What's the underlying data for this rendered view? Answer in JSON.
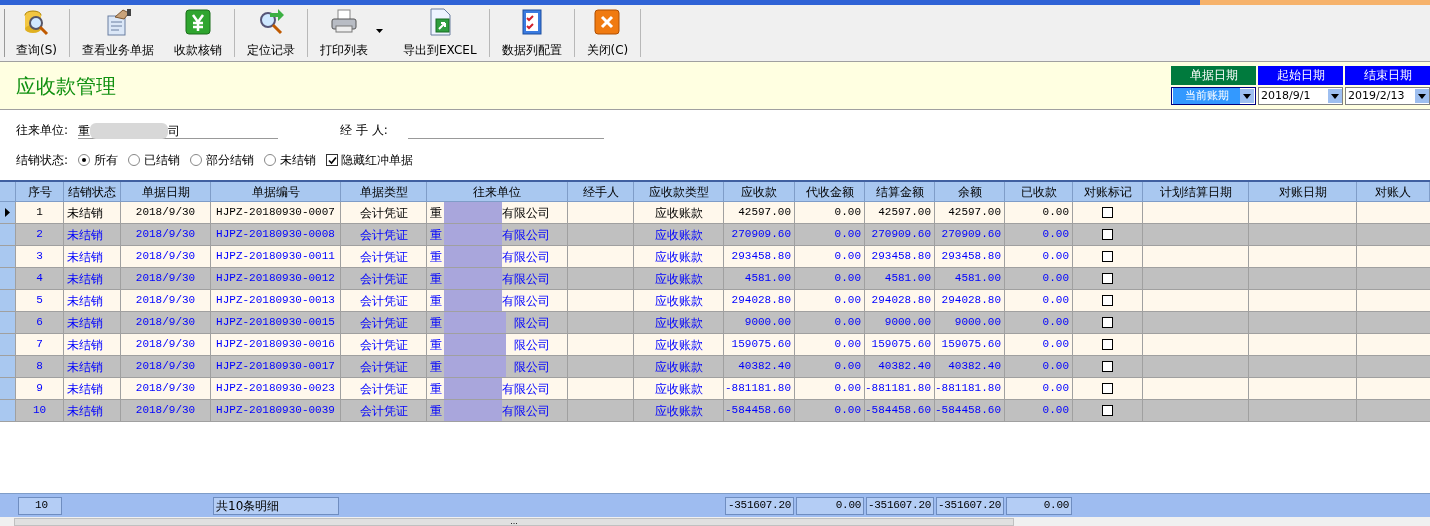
{
  "toolbar": [
    {
      "kind": "query",
      "label": "查询(S)",
      "has_menu": false
    },
    {
      "kind": "document",
      "label": "查看业务单据",
      "has_menu": false
    },
    {
      "kind": "yen",
      "label": "收款核销",
      "has_menu": false
    },
    {
      "kind": "locate",
      "label": "定位记录",
      "has_menu": false
    },
    {
      "kind": "print",
      "label": "打印列表",
      "has_menu": true
    },
    {
      "kind": "export",
      "label": "导出到EXCEL",
      "has_menu": false
    },
    {
      "kind": "checklist",
      "label": "数据列配置",
      "has_menu": false
    },
    {
      "kind": "close",
      "label": "关闭(C)",
      "has_menu": false
    }
  ],
  "page_title": "应收款管理",
  "date_filters": [
    {
      "label": "单据日期",
      "color": "#007a3d",
      "value": "当前账期",
      "selected": true
    },
    {
      "label": "起始日期",
      "color": "#0000ff",
      "value": "2018/9/1",
      "selected": false
    },
    {
      "label": "结束日期",
      "color": "#0000ff",
      "value": "2019/2/13",
      "selected": false
    }
  ],
  "partner_field": {
    "label": "往来单位:",
    "value_start": "重",
    "value_end": "司"
  },
  "handler_field": {
    "label": "经 手 人:"
  },
  "status_filter": {
    "label": "结销状态:",
    "options": [
      {
        "label": "所有",
        "selected": true
      },
      {
        "label": "已结销",
        "selected": false
      },
      {
        "label": "部分结销",
        "selected": false
      },
      {
        "label": "未结销",
        "selected": false
      }
    ]
  },
  "hide_red_reversal": {
    "label": "隐藏红冲单据",
    "checked": true
  },
  "table": {
    "columns": [
      "序号",
      "结销状态",
      "单据日期",
      "单据编号",
      "单据类型",
      "往来单位",
      "经手人",
      "应收款类型",
      "应收款",
      "代收金额",
      "结算金额",
      "余额",
      "已收款",
      "对账标记",
      "计划结算日期",
      "对账日期",
      "对账人"
    ],
    "rows": [
      {
        "selected": true,
        "seq": "1",
        "status": "未结销",
        "date": "2018/9/30",
        "number": "HJPZ-20180930-0007",
        "type": "会计凭证",
        "partner_start": "重",
        "partner_end": "有限公司",
        "ar_type": "应收账款",
        "amount": "42597.00",
        "collected": "0.00",
        "settled": "42597.00",
        "balance": "42597.00",
        "received": "0.00",
        "reconciled": false
      },
      {
        "selected": false,
        "seq": "2",
        "status": "未结销",
        "date": "2018/9/30",
        "number": "HJPZ-20180930-0008",
        "type": "会计凭证",
        "partner_start": "重",
        "partner_end": "有限公司",
        "ar_type": "应收账款",
        "amount": "270909.60",
        "collected": "0.00",
        "settled": "270909.60",
        "balance": "270909.60",
        "received": "0.00",
        "reconciled": false
      },
      {
        "selected": false,
        "seq": "3",
        "status": "未结销",
        "date": "2018/9/30",
        "number": "HJPZ-20180930-0011",
        "type": "会计凭证",
        "partner_start": "重",
        "partner_end": "有限公司",
        "ar_type": "应收账款",
        "amount": "293458.80",
        "collected": "0.00",
        "settled": "293458.80",
        "balance": "293458.80",
        "received": "0.00",
        "reconciled": false
      },
      {
        "selected": false,
        "seq": "4",
        "status": "未结销",
        "date": "2018/9/30",
        "number": "HJPZ-20180930-0012",
        "type": "会计凭证",
        "partner_start": "重",
        "partner_end": "有限公司",
        "ar_type": "应收账款",
        "amount": "4581.00",
        "collected": "0.00",
        "settled": "4581.00",
        "balance": "4581.00",
        "received": "0.00",
        "reconciled": false
      },
      {
        "selected": false,
        "seq": "5",
        "status": "未结销",
        "date": "2018/9/30",
        "number": "HJPZ-20180930-0013",
        "type": "会计凭证",
        "partner_start": "重",
        "partner_end": "有限公司",
        "ar_type": "应收账款",
        "amount": "294028.80",
        "collected": "0.00",
        "settled": "294028.80",
        "balance": "294028.80",
        "received": "0.00",
        "reconciled": false
      },
      {
        "selected": false,
        "seq": "6",
        "status": "未结销",
        "date": "2018/9/30",
        "number": "HJPZ-20180930-0015",
        "type": "会计凭证",
        "partner_start": "重",
        "partner_end": "限公司",
        "ar_type": "应收账款",
        "amount": "9000.00",
        "collected": "0.00",
        "settled": "9000.00",
        "balance": "9000.00",
        "received": "0.00",
        "reconciled": false
      },
      {
        "selected": false,
        "seq": "7",
        "status": "未结销",
        "date": "2018/9/30",
        "number": "HJPZ-20180930-0016",
        "type": "会计凭证",
        "partner_start": "重",
        "partner_end": "限公司",
        "ar_type": "应收账款",
        "amount": "159075.60",
        "collected": "0.00",
        "settled": "159075.60",
        "balance": "159075.60",
        "received": "0.00",
        "reconciled": false
      },
      {
        "selected": false,
        "seq": "8",
        "status": "未结销",
        "date": "2018/9/30",
        "number": "HJPZ-20180930-0017",
        "type": "会计凭证",
        "partner_start": "重",
        "partner_end": "限公司",
        "ar_type": "应收账款",
        "amount": "40382.40",
        "collected": "0.00",
        "settled": "40382.40",
        "balance": "40382.40",
        "received": "0.00",
        "reconciled": false
      },
      {
        "selected": false,
        "seq": "9",
        "status": "未结销",
        "date": "2018/9/30",
        "number": "HJPZ-20180930-0023",
        "type": "会计凭证",
        "partner_start": "重",
        "partner_end": "有限公司",
        "ar_type": "应收账款",
        "amount": "-881181.80",
        "collected": "0.00",
        "settled": "-881181.80",
        "balance": "-881181.80",
        "received": "0.00",
        "reconciled": false
      },
      {
        "selected": false,
        "seq": "10",
        "status": "未结销",
        "date": "2018/9/30",
        "number": "HJPZ-20180930-0039",
        "type": "会计凭证",
        "partner_start": "重",
        "partner_end": "有限公司",
        "ar_type": "应收账款",
        "amount": "-584458.60",
        "collected": "0.00",
        "settled": "-584458.60",
        "balance": "-584458.60",
        "received": "0.00",
        "reconciled": false
      }
    ],
    "footer": {
      "count": "10",
      "summary": "共10条明细",
      "amount": "-351607.20",
      "collected": "0.00",
      "settled": "-351607.20",
      "balance": "-351607.20",
      "received": "0.00"
    }
  },
  "scrollbar_grip": "..."
}
